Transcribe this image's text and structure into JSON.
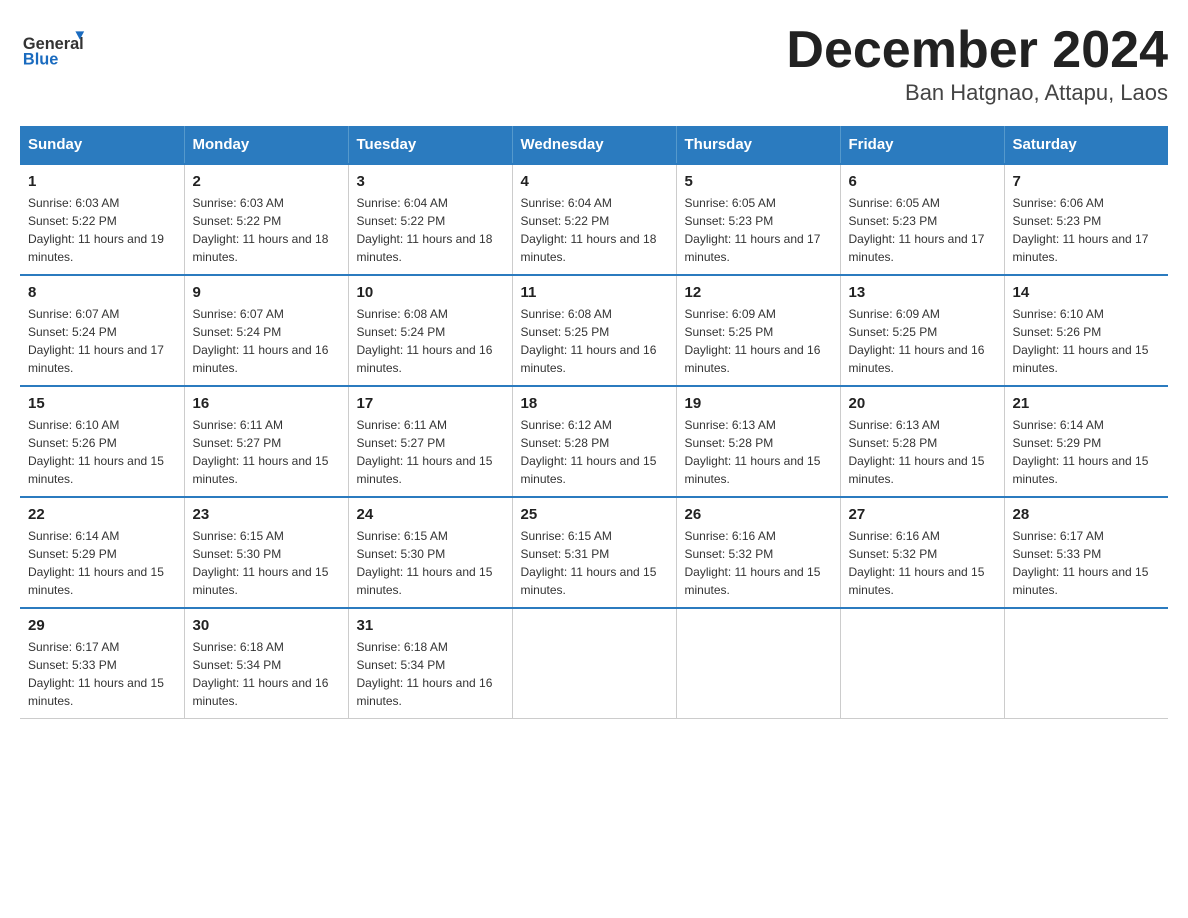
{
  "header": {
    "logo_general": "General",
    "logo_blue": "Blue",
    "month_title": "December 2024",
    "location": "Ban Hatgnao, Attapu, Laos"
  },
  "weekdays": [
    "Sunday",
    "Monday",
    "Tuesday",
    "Wednesday",
    "Thursday",
    "Friday",
    "Saturday"
  ],
  "weeks": [
    [
      {
        "day": "1",
        "sunrise": "6:03 AM",
        "sunset": "5:22 PM",
        "daylight": "11 hours and 19 minutes."
      },
      {
        "day": "2",
        "sunrise": "6:03 AM",
        "sunset": "5:22 PM",
        "daylight": "11 hours and 18 minutes."
      },
      {
        "day": "3",
        "sunrise": "6:04 AM",
        "sunset": "5:22 PM",
        "daylight": "11 hours and 18 minutes."
      },
      {
        "day": "4",
        "sunrise": "6:04 AM",
        "sunset": "5:22 PM",
        "daylight": "11 hours and 18 minutes."
      },
      {
        "day": "5",
        "sunrise": "6:05 AM",
        "sunset": "5:23 PM",
        "daylight": "11 hours and 17 minutes."
      },
      {
        "day": "6",
        "sunrise": "6:05 AM",
        "sunset": "5:23 PM",
        "daylight": "11 hours and 17 minutes."
      },
      {
        "day": "7",
        "sunrise": "6:06 AM",
        "sunset": "5:23 PM",
        "daylight": "11 hours and 17 minutes."
      }
    ],
    [
      {
        "day": "8",
        "sunrise": "6:07 AM",
        "sunset": "5:24 PM",
        "daylight": "11 hours and 17 minutes."
      },
      {
        "day": "9",
        "sunrise": "6:07 AM",
        "sunset": "5:24 PM",
        "daylight": "11 hours and 16 minutes."
      },
      {
        "day": "10",
        "sunrise": "6:08 AM",
        "sunset": "5:24 PM",
        "daylight": "11 hours and 16 minutes."
      },
      {
        "day": "11",
        "sunrise": "6:08 AM",
        "sunset": "5:25 PM",
        "daylight": "11 hours and 16 minutes."
      },
      {
        "day": "12",
        "sunrise": "6:09 AM",
        "sunset": "5:25 PM",
        "daylight": "11 hours and 16 minutes."
      },
      {
        "day": "13",
        "sunrise": "6:09 AM",
        "sunset": "5:25 PM",
        "daylight": "11 hours and 16 minutes."
      },
      {
        "day": "14",
        "sunrise": "6:10 AM",
        "sunset": "5:26 PM",
        "daylight": "11 hours and 15 minutes."
      }
    ],
    [
      {
        "day": "15",
        "sunrise": "6:10 AM",
        "sunset": "5:26 PM",
        "daylight": "11 hours and 15 minutes."
      },
      {
        "day": "16",
        "sunrise": "6:11 AM",
        "sunset": "5:27 PM",
        "daylight": "11 hours and 15 minutes."
      },
      {
        "day": "17",
        "sunrise": "6:11 AM",
        "sunset": "5:27 PM",
        "daylight": "11 hours and 15 minutes."
      },
      {
        "day": "18",
        "sunrise": "6:12 AM",
        "sunset": "5:28 PM",
        "daylight": "11 hours and 15 minutes."
      },
      {
        "day": "19",
        "sunrise": "6:13 AM",
        "sunset": "5:28 PM",
        "daylight": "11 hours and 15 minutes."
      },
      {
        "day": "20",
        "sunrise": "6:13 AM",
        "sunset": "5:28 PM",
        "daylight": "11 hours and 15 minutes."
      },
      {
        "day": "21",
        "sunrise": "6:14 AM",
        "sunset": "5:29 PM",
        "daylight": "11 hours and 15 minutes."
      }
    ],
    [
      {
        "day": "22",
        "sunrise": "6:14 AM",
        "sunset": "5:29 PM",
        "daylight": "11 hours and 15 minutes."
      },
      {
        "day": "23",
        "sunrise": "6:15 AM",
        "sunset": "5:30 PM",
        "daylight": "11 hours and 15 minutes."
      },
      {
        "day": "24",
        "sunrise": "6:15 AM",
        "sunset": "5:30 PM",
        "daylight": "11 hours and 15 minutes."
      },
      {
        "day": "25",
        "sunrise": "6:15 AM",
        "sunset": "5:31 PM",
        "daylight": "11 hours and 15 minutes."
      },
      {
        "day": "26",
        "sunrise": "6:16 AM",
        "sunset": "5:32 PM",
        "daylight": "11 hours and 15 minutes."
      },
      {
        "day": "27",
        "sunrise": "6:16 AM",
        "sunset": "5:32 PM",
        "daylight": "11 hours and 15 minutes."
      },
      {
        "day": "28",
        "sunrise": "6:17 AM",
        "sunset": "5:33 PM",
        "daylight": "11 hours and 15 minutes."
      }
    ],
    [
      {
        "day": "29",
        "sunrise": "6:17 AM",
        "sunset": "5:33 PM",
        "daylight": "11 hours and 15 minutes."
      },
      {
        "day": "30",
        "sunrise": "6:18 AM",
        "sunset": "5:34 PM",
        "daylight": "11 hours and 16 minutes."
      },
      {
        "day": "31",
        "sunrise": "6:18 AM",
        "sunset": "5:34 PM",
        "daylight": "11 hours and 16 minutes."
      },
      null,
      null,
      null,
      null
    ]
  ]
}
